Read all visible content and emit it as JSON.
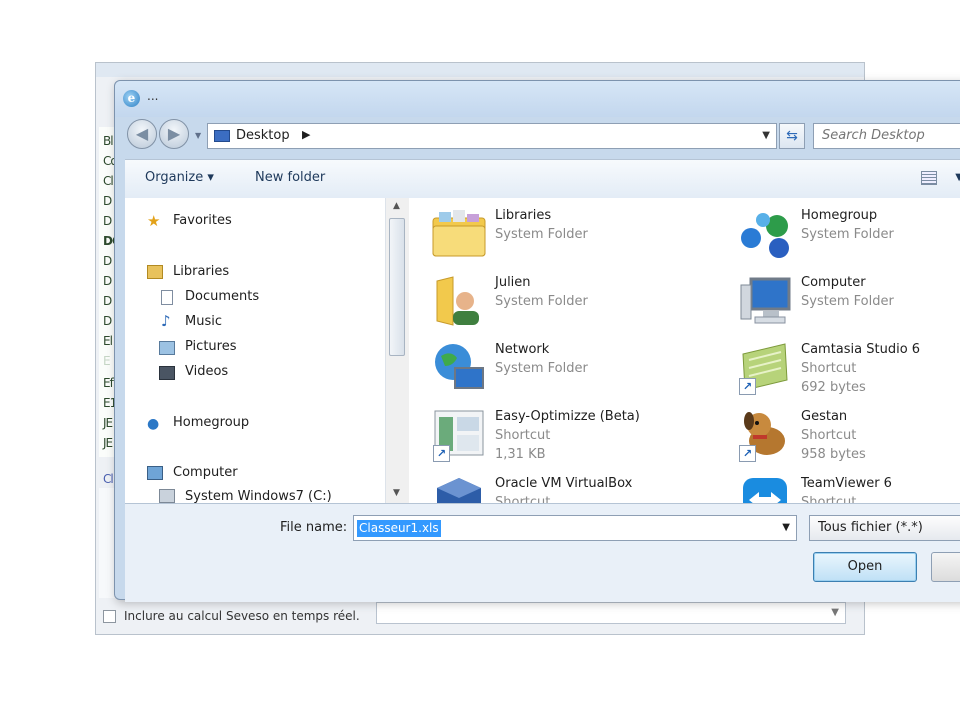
{
  "dialog": {
    "title": "...",
    "address": {
      "location": "Desktop"
    },
    "search": {
      "placeholder": "Search Desktop"
    },
    "toolbar": {
      "organize": "Organize ▾",
      "new_folder": "New folder"
    },
    "nav": {
      "favorites": "Favorites",
      "libraries": "Libraries",
      "documents": "Documents",
      "music": "Music",
      "pictures": "Pictures",
      "videos": "Videos",
      "homegroup": "Homegroup",
      "computer": "Computer",
      "system_drive": "System Windows7 (C:)"
    },
    "files": [
      {
        "name": "Libraries",
        "type": "System Folder",
        "size": "",
        "icon": "libraries-folder-icon"
      },
      {
        "name": "Homegroup",
        "type": "System Folder",
        "size": "",
        "icon": "homegroup-icon"
      },
      {
        "name": "Julien",
        "type": "System Folder",
        "size": "",
        "icon": "user-folder-icon"
      },
      {
        "name": "Computer",
        "type": "System Folder",
        "size": "",
        "icon": "computer-icon"
      },
      {
        "name": "Network",
        "type": "System Folder",
        "size": "",
        "icon": "network-icon"
      },
      {
        "name": "Camtasia Studio 6",
        "type": "Shortcut",
        "size": "692 bytes",
        "icon": "camtasia-icon"
      },
      {
        "name": "Easy-Optimizze (Beta)",
        "type": "Shortcut",
        "size": "1,31 KB",
        "icon": "app-window-icon"
      },
      {
        "name": "Gestan",
        "type": "Shortcut",
        "size": "958 bytes",
        "icon": "dog-icon"
      },
      {
        "name": "Oracle VM VirtualBox",
        "type": "Shortcut",
        "size": "",
        "icon": "virtualbox-icon"
      },
      {
        "name": "TeamViewer 6",
        "type": "Shortcut",
        "size": "",
        "icon": "teamviewer-icon"
      }
    ],
    "file_name_label": "File name:",
    "file_name_value": "Classeur1.xls",
    "file_type_value": "Tous fichier (*.*)",
    "open_button": "Open"
  },
  "background": {
    "checkbox_label": "Inclure au calcul Seveso en temps réel.",
    "list_items": [
      "Bl",
      "Co",
      "Cl",
      "D",
      "D",
      "DC",
      "D",
      "D",
      "D",
      "D",
      "El",
      "E",
      "Ef",
      "E1",
      "JE",
      "JE"
    ],
    "grid_label": "Cl"
  }
}
